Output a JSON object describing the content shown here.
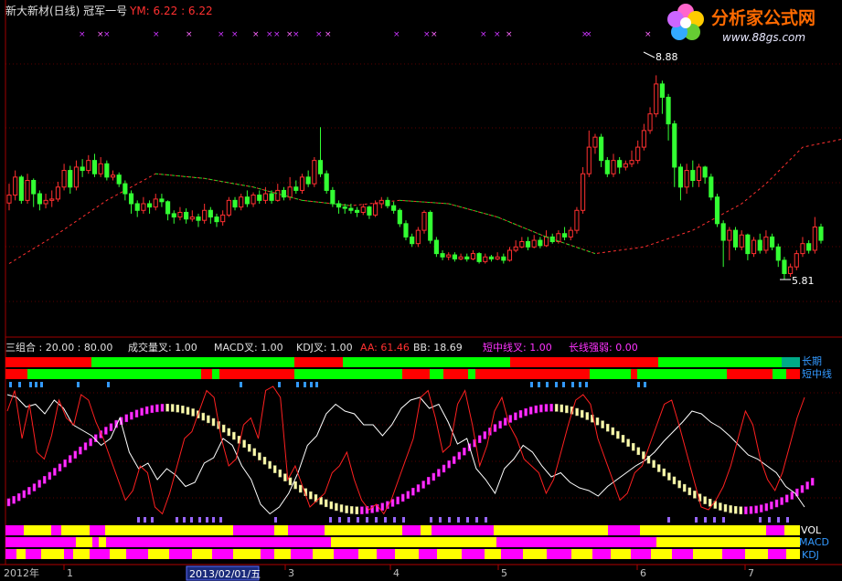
{
  "header": {
    "title": "新大新材(日线) 冠军一号",
    "ym_label": "YM: 6.22 : 6.22"
  },
  "watermark": {
    "site_name": "分析家公式网",
    "site_url": "www.88gs.com"
  },
  "indicator_bar": {
    "combo": "三组合 : 20.00 : 80.00",
    "vol_cross": "成交量叉: 1.00",
    "macd_cross": "MACD叉: 1.00",
    "kdj_cross": "KDJ叉: 1.00",
    "aa": "AA: 61.46",
    "bb": "BB: 18.69",
    "mid_cross": "短中线叉: 1.00",
    "long_strength": "长线强弱: 0.00"
  },
  "band_labels": {
    "long_term": "长期",
    "short_term": "短中线",
    "vol": "VOL",
    "macd": "MACD",
    "kdj": "KDJ"
  },
  "x_axis": {
    "year_label": "2012年",
    "tick_labels": [
      "1",
      "3",
      "4",
      "5",
      "6",
      "7"
    ],
    "cursor_date": "2013/02/01/五"
  },
  "colors": {
    "up": "#ff3030",
    "down": "#33ff33",
    "bull_band": "#00ff00",
    "bear_band": "#ff0000",
    "magenta": "#ff00ff",
    "yellow": "#ffff00",
    "axis": "#b00000"
  },
  "chart_data": [
    {
      "type": "candlestick",
      "title": "新大新材(日线) 冠军一号",
      "high_annotation": "8.88",
      "low_annotation": "5.81",
      "ylim": [
        5.0,
        9.6
      ],
      "candles": [
        [
          6.96,
          7.08,
          7.25,
          6.85
        ],
        [
          7.08,
          7.35,
          7.45,
          7.0
        ],
        [
          7.35,
          7.0,
          7.38,
          6.95
        ],
        [
          7.0,
          7.3,
          7.4,
          6.95
        ],
        [
          7.3,
          7.1,
          7.33,
          6.9
        ],
        [
          7.1,
          6.95,
          7.15,
          6.85
        ],
        [
          6.95,
          7.0,
          7.1,
          6.88
        ],
        [
          7.0,
          7.02,
          7.15,
          6.9
        ],
        [
          7.02,
          7.2,
          7.28,
          6.98
        ],
        [
          7.2,
          7.45,
          7.55,
          7.15
        ],
        [
          7.45,
          7.2,
          7.52,
          7.1
        ],
        [
          7.2,
          7.5,
          7.6,
          7.15
        ],
        [
          7.5,
          7.45,
          7.62,
          7.35
        ],
        [
          7.45,
          7.6,
          7.68,
          7.4
        ],
        [
          7.6,
          7.4,
          7.7,
          7.35
        ],
        [
          7.4,
          7.55,
          7.65,
          7.35
        ],
        [
          7.55,
          7.35,
          7.6,
          7.3
        ],
        [
          7.35,
          7.38,
          7.45,
          7.3
        ],
        [
          7.38,
          7.25,
          7.42,
          7.2
        ],
        [
          7.25,
          7.1,
          7.3,
          7.0
        ],
        [
          7.1,
          6.95,
          7.15,
          6.8
        ],
        [
          6.95,
          6.85,
          7.0,
          6.75
        ],
        [
          6.85,
          6.95,
          7.05,
          6.8
        ],
        [
          6.95,
          6.9,
          7.0,
          6.8
        ],
        [
          6.9,
          7.02,
          7.1,
          6.85
        ],
        [
          7.02,
          6.98,
          7.1,
          6.9
        ],
        [
          6.98,
          6.8,
          7.0,
          6.7
        ],
        [
          6.8,
          6.75,
          6.85,
          6.65
        ],
        [
          6.75,
          6.82,
          6.9,
          6.7
        ],
        [
          6.82,
          6.72,
          6.88,
          6.65
        ],
        [
          6.72,
          6.75,
          6.85,
          6.68
        ],
        [
          6.75,
          6.7,
          6.8,
          6.6
        ],
        [
          6.7,
          6.85,
          6.95,
          6.65
        ],
        [
          6.85,
          6.75,
          6.9,
          6.65
        ],
        [
          6.75,
          6.68,
          6.8,
          6.6
        ],
        [
          6.68,
          6.78,
          6.85,
          6.62
        ],
        [
          6.78,
          7.0,
          7.05,
          6.75
        ],
        [
          7.0,
          6.9,
          7.05,
          6.85
        ],
        [
          6.9,
          7.05,
          7.1,
          6.85
        ],
        [
          7.05,
          6.95,
          7.15,
          6.9
        ],
        [
          6.95,
          7.08,
          7.12,
          6.9
        ],
        [
          7.08,
          7.0,
          7.15,
          6.95
        ],
        [
          7.0,
          7.1,
          7.2,
          6.95
        ],
        [
          7.1,
          7.0,
          7.15,
          6.95
        ],
        [
          7.0,
          7.15,
          7.25,
          6.98
        ],
        [
          7.15,
          7.05,
          7.2,
          7.0
        ],
        [
          7.05,
          7.2,
          7.35,
          7.0
        ],
        [
          7.2,
          7.15,
          7.3,
          7.1
        ],
        [
          7.15,
          7.35,
          7.4,
          7.1
        ],
        [
          7.35,
          7.25,
          7.45,
          7.2
        ],
        [
          7.25,
          7.6,
          7.65,
          7.2
        ],
        [
          7.6,
          7.4,
          8.1,
          7.35
        ],
        [
          7.4,
          7.15,
          7.45,
          7.1
        ],
        [
          7.15,
          6.95,
          7.2,
          6.9
        ],
        [
          6.95,
          6.9,
          7.0,
          6.8
        ],
        [
          6.9,
          6.88,
          6.95,
          6.8
        ],
        [
          6.88,
          6.85,
          6.95,
          6.8
        ],
        [
          6.85,
          6.82,
          6.9,
          6.75
        ],
        [
          6.82,
          6.9,
          6.95,
          6.78
        ],
        [
          6.9,
          6.78,
          6.92,
          6.72
        ],
        [
          6.78,
          6.95,
          7.0,
          6.75
        ],
        [
          6.95,
          7.0,
          7.05,
          6.88
        ],
        [
          7.0,
          6.92,
          7.05,
          6.88
        ],
        [
          6.92,
          6.85,
          6.98,
          6.8
        ],
        [
          6.85,
          6.65,
          6.88,
          6.6
        ],
        [
          6.65,
          6.45,
          6.7,
          6.4
        ],
        [
          6.45,
          6.35,
          6.5,
          6.3
        ],
        [
          6.35,
          6.55,
          6.6,
          6.3
        ],
        [
          6.55,
          6.82,
          6.85,
          6.5
        ],
        [
          6.82,
          6.4,
          6.85,
          6.35
        ],
        [
          6.4,
          6.2,
          6.45,
          6.15
        ],
        [
          6.2,
          6.15,
          6.25,
          6.1
        ],
        [
          6.15,
          6.18,
          6.22,
          6.1
        ],
        [
          6.18,
          6.12,
          6.22,
          6.08
        ],
        [
          6.12,
          6.15,
          6.2,
          6.1
        ],
        [
          6.15,
          6.12,
          6.2,
          6.08
        ],
        [
          6.12,
          6.2,
          6.25,
          6.1
        ],
        [
          6.2,
          6.08,
          6.22,
          6.05
        ],
        [
          6.08,
          6.15,
          6.2,
          6.05
        ],
        [
          6.15,
          6.12,
          6.18,
          6.08
        ],
        [
          6.12,
          6.15,
          6.22,
          6.1
        ],
        [
          6.15,
          6.1,
          6.2,
          6.05
        ],
        [
          6.1,
          6.25,
          6.3,
          6.08
        ],
        [
          6.25,
          6.3,
          6.4,
          6.22
        ],
        [
          6.3,
          6.38,
          6.45,
          6.28
        ],
        [
          6.38,
          6.3,
          6.45,
          6.25
        ],
        [
          6.3,
          6.4,
          6.48,
          6.28
        ],
        [
          6.4,
          6.32,
          6.45,
          6.28
        ],
        [
          6.32,
          6.45,
          6.55,
          6.3
        ],
        [
          6.45,
          6.38,
          6.5,
          6.35
        ],
        [
          6.38,
          6.5,
          6.55,
          6.35
        ],
        [
          6.5,
          6.45,
          6.6,
          6.4
        ],
        [
          6.45,
          6.55,
          6.6,
          6.4
        ],
        [
          6.55,
          6.85,
          6.9,
          6.5
        ],
        [
          6.85,
          7.4,
          7.5,
          6.8
        ],
        [
          7.4,
          7.8,
          8.05,
          7.35
        ],
        [
          7.8,
          7.95,
          8.0,
          7.7
        ],
        [
          7.95,
          7.6,
          8.0,
          7.5
        ],
        [
          7.6,
          7.4,
          7.65,
          7.35
        ],
        [
          7.4,
          7.6,
          7.7,
          7.35
        ],
        [
          7.6,
          7.5,
          7.65,
          7.4
        ],
        [
          7.5,
          7.55,
          7.6,
          7.45
        ],
        [
          7.55,
          7.6,
          7.75,
          7.5
        ],
        [
          7.6,
          7.8,
          7.9,
          7.55
        ],
        [
          7.8,
          8.05,
          8.15,
          7.75
        ],
        [
          8.05,
          8.3,
          8.4,
          8.0
        ],
        [
          8.3,
          8.75,
          8.88,
          8.25
        ],
        [
          8.75,
          8.55,
          8.8,
          8.3
        ],
        [
          8.55,
          8.15,
          8.6,
          7.9
        ],
        [
          8.15,
          7.5,
          8.2,
          7.2
        ],
        [
          7.5,
          7.2,
          7.55,
          7.0
        ],
        [
          7.2,
          7.45,
          7.55,
          7.1
        ],
        [
          7.45,
          7.3,
          7.6,
          7.2
        ],
        [
          7.3,
          7.5,
          7.55,
          7.2
        ],
        [
          7.5,
          7.35,
          7.52,
          7.25
        ],
        [
          7.35,
          7.05,
          7.4,
          7.0
        ],
        [
          7.05,
          6.65,
          7.1,
          6.6
        ],
        [
          6.65,
          6.4,
          6.7,
          6.0
        ],
        [
          6.4,
          6.55,
          6.6,
          6.1
        ],
        [
          6.55,
          6.3,
          6.6,
          6.25
        ],
        [
          6.3,
          6.48,
          6.55,
          6.25
        ],
        [
          6.48,
          6.2,
          6.5,
          6.1
        ],
        [
          6.2,
          6.4,
          6.45,
          6.15
        ],
        [
          6.4,
          6.25,
          6.5,
          6.2
        ],
        [
          6.25,
          6.45,
          6.55,
          6.2
        ],
        [
          6.45,
          6.3,
          6.5,
          6.25
        ],
        [
          6.3,
          6.1,
          6.35,
          6.0
        ],
        [
          6.1,
          5.9,
          6.15,
          5.81
        ],
        [
          5.9,
          6.0,
          6.05,
          5.85
        ],
        [
          6.0,
          6.2,
          6.25,
          5.95
        ],
        [
          6.2,
          6.35,
          6.45,
          6.15
        ],
        [
          6.35,
          6.25,
          6.4,
          6.2
        ],
        [
          6.25,
          6.6,
          6.75,
          6.2
        ],
        [
          6.6,
          6.4,
          6.65,
          6.35
        ]
      ],
      "trend_line": [
        [
          0,
          6.05
        ],
        [
          8,
          6.5
        ],
        [
          16,
          7.0
        ],
        [
          24,
          7.4
        ],
        [
          32,
          7.33
        ],
        [
          40,
          7.2
        ],
        [
          48,
          7.0
        ],
        [
          56,
          6.92
        ],
        [
          64,
          7.0
        ],
        [
          72,
          6.95
        ],
        [
          80,
          6.75
        ],
        [
          88,
          6.45
        ],
        [
          96,
          6.2
        ],
        [
          104,
          6.3
        ],
        [
          112,
          6.55
        ],
        [
          120,
          6.95
        ],
        [
          124,
          7.25
        ],
        [
          130,
          7.8
        ],
        [
          138,
          7.95
        ],
        [
          146,
          7.7
        ],
        [
          154,
          7.15
        ],
        [
          160,
          6.6
        ],
        [
          166,
          6.2
        ]
      ]
    },
    {
      "type": "line",
      "series": [
        {
          "values": [
            92,
            90,
            83,
            85,
            78,
            88,
            82,
            70,
            66,
            62,
            55,
            60,
            75,
            50,
            38,
            42,
            30,
            38,
            33,
            25,
            28,
            42,
            46,
            60,
            55,
            40,
            30,
            12,
            5,
            10,
            20,
            35,
            55,
            62,
            78,
            85,
            80,
            78,
            70,
            70,
            62,
            70,
            82,
            88,
            90,
            82,
            85,
            72,
            56,
            60,
            38,
            30,
            20,
            38,
            45,
            55,
            50,
            40,
            32,
            35,
            28,
            24,
            22,
            18,
            25,
            30,
            35,
            40,
            44,
            50,
            58,
            65,
            72,
            80,
            78,
            72,
            68,
            62,
            55,
            48,
            45,
            40,
            35,
            25,
            20,
            10
          ]
        },
        {
          "values": [
            80,
            95,
            60,
            85,
            50,
            45,
            62,
            88,
            75,
            70,
            92,
            88,
            72,
            60,
            45,
            30,
            15,
            22,
            40,
            35,
            10,
            5,
            20,
            40,
            60,
            65,
            80,
            95,
            90,
            60,
            40,
            45,
            70,
            75,
            60,
            95,
            98,
            90,
            30,
            40,
            25,
            10,
            15,
            20,
            35,
            40,
            50,
            30,
            15,
            8,
            12,
            5,
            15,
            30,
            45,
            60,
            90,
            95,
            75,
            50,
            55,
            85,
            95,
            70,
            40,
            55,
            80,
            90,
            70,
            60,
            45,
            40,
            35,
            20,
            30,
            50,
            70,
            88,
            92,
            85,
            60,
            45,
            30,
            15,
            20,
            35,
            40,
            55,
            70,
            85,
            88,
            70,
            50,
            30,
            10,
            8,
            15,
            25,
            40,
            60,
            80,
            70,
            45,
            30,
            22,
            35,
            55,
            75,
            90
          ]
        }
      ],
      "ylim": [
        0,
        100
      ]
    }
  ]
}
